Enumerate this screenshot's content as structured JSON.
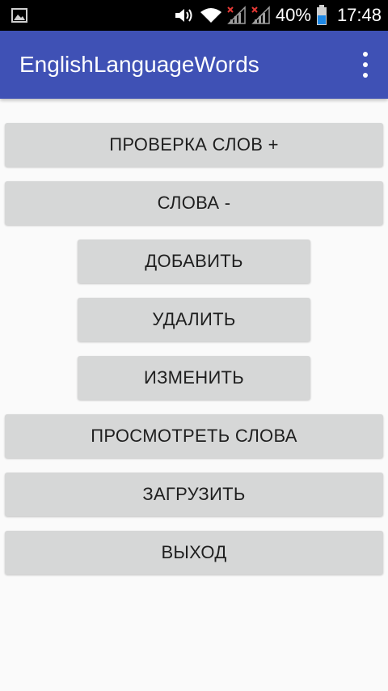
{
  "status_bar": {
    "battery_percent": "40%",
    "time": "17:48",
    "icons": [
      "image-notification-icon",
      "volume-icon",
      "wifi-icon",
      "signal-no-service-icon",
      "signal-no-service-icon",
      "battery-icon"
    ]
  },
  "app_bar": {
    "title": "EnglishLanguageWords",
    "color": "#3f51b5",
    "menu_icon": "overflow-menu-icon"
  },
  "buttons": [
    {
      "label": "ПРОВЕРКА СЛОВ +"
    },
    {
      "label": "СЛОВА -"
    },
    {
      "label": "ДОБАВИТЬ"
    },
    {
      "label": "УДАЛИТЬ"
    },
    {
      "label": "ИЗМЕНИТЬ"
    },
    {
      "label": "ПРОСМОТРЕТЬ СЛОВА"
    },
    {
      "label": "ЗАГРУЗИТЬ"
    },
    {
      "label": "ВЫХОД"
    }
  ]
}
